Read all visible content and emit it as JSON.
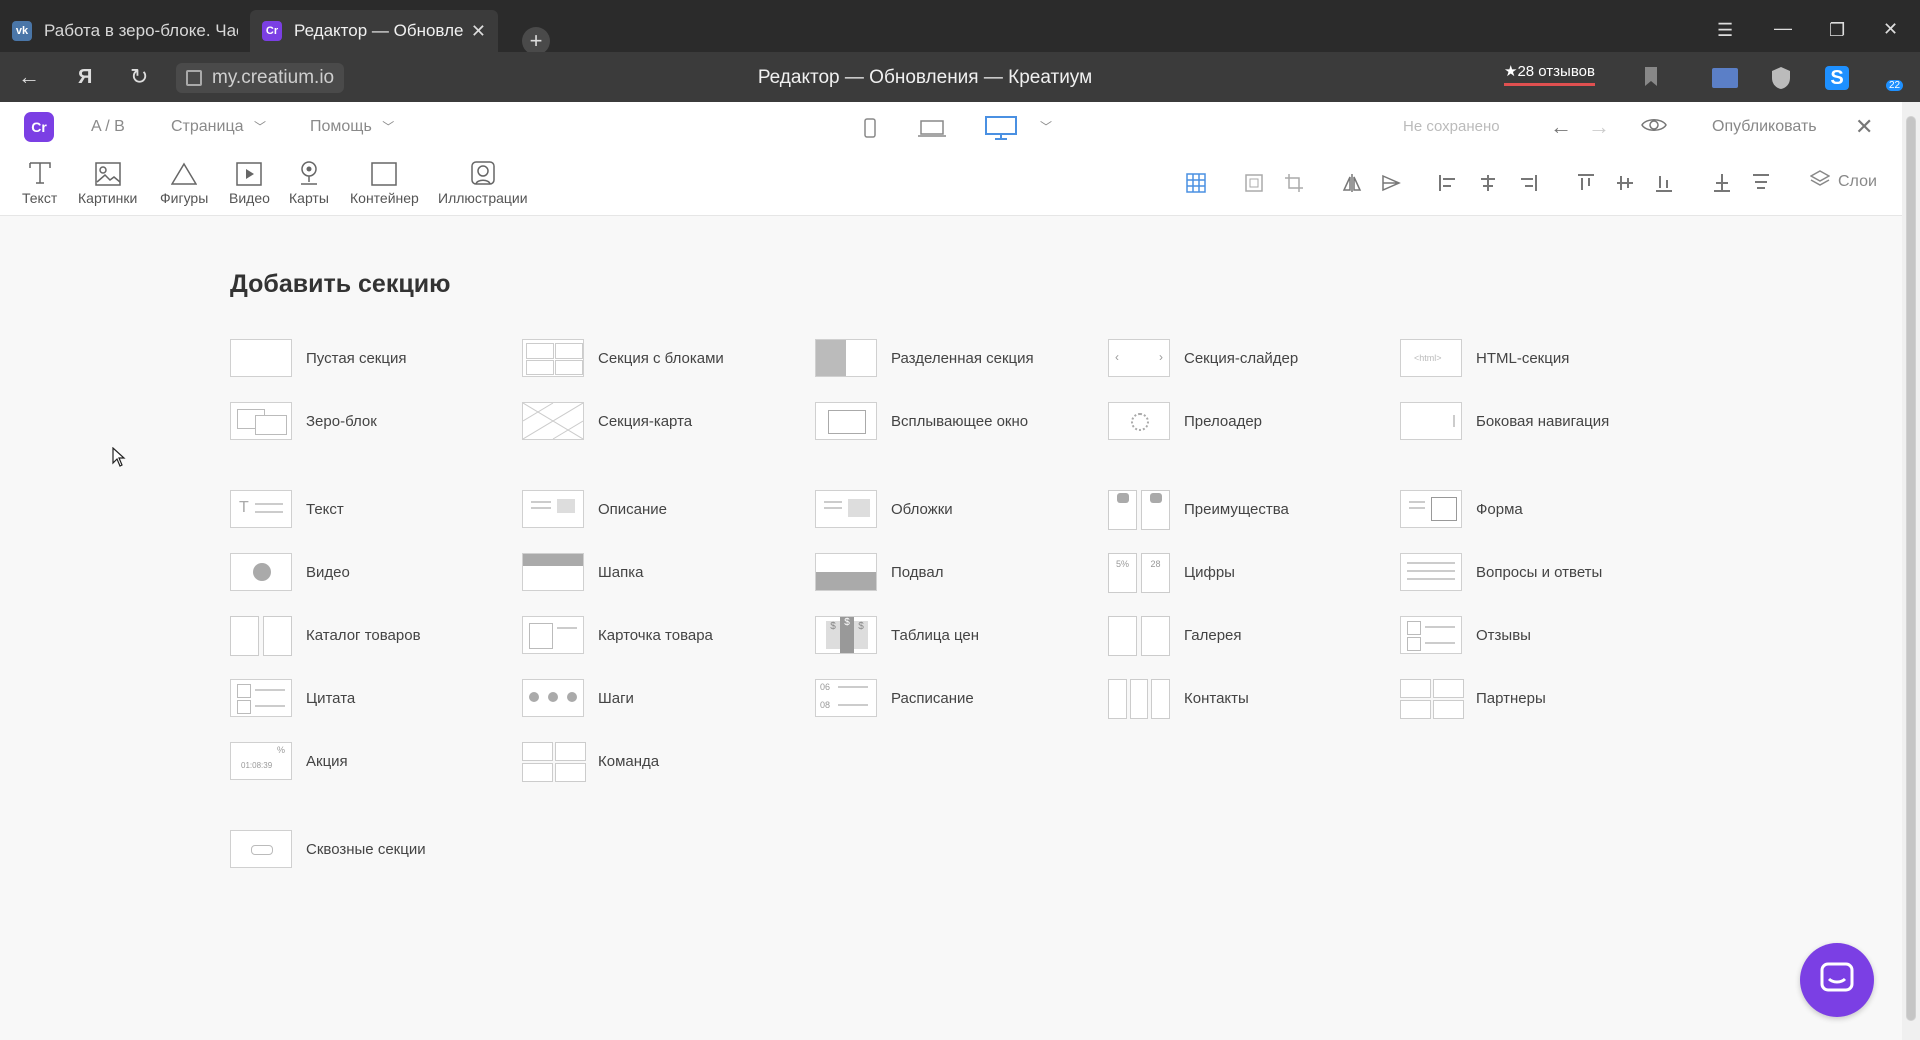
{
  "browser": {
    "tabs": [
      {
        "title": "Работа в зеро-блоке. Час",
        "favicon": "vk-icon",
        "active": false
      },
      {
        "title": "Редактор — Обновлени",
        "favicon": "creatium-icon",
        "active": true
      }
    ],
    "new_tab_symbol": "+",
    "url": "my.creatium.io",
    "page_title": "Редактор — Обновления — Креатиум",
    "reviews_label": "★28 отзывов",
    "ext_badge": "22",
    "colors": {
      "chrome_dark": "#2b2b2b",
      "chrome_mid": "#3b3b3b",
      "vk_blue": "#4a76a8",
      "ext_blue": "#1e90ff"
    }
  },
  "editor": {
    "ab_label": "A / B",
    "menu": {
      "page": "Страница",
      "help": "Помощь"
    },
    "status": "Не сохранено",
    "publish": "Опубликовать",
    "layers": "Слои",
    "tools": [
      {
        "label": "Текст",
        "icon": "text-icon"
      },
      {
        "label": "Картинки",
        "icon": "image-icon"
      },
      {
        "label": "Фигуры",
        "icon": "shape-icon"
      },
      {
        "label": "Видео",
        "icon": "video-icon"
      },
      {
        "label": "Карты",
        "icon": "map-pin-icon"
      },
      {
        "label": "Контейнер",
        "icon": "container-icon"
      },
      {
        "label": "Иллюстрации",
        "icon": "illustration-icon"
      }
    ],
    "accent": "#7b3fe4",
    "active_device": "desktop"
  },
  "sections": {
    "heading": "Добавить секцию",
    "group1": [
      [
        "Пустая секция",
        "Секция с блоками",
        "Разделенная секция",
        "Секция-слайдер",
        "HTML-секция"
      ],
      [
        "Зеро-блок",
        "Секция-карта",
        "Всплывающее окно",
        "Прелоадер",
        "Боковая навигация"
      ]
    ],
    "group2": [
      [
        "Текст",
        "Описание",
        "Обложки",
        "Преимущества",
        "Форма"
      ],
      [
        "Видео",
        "Шапка",
        "Подвал",
        "Цифры",
        "Вопросы и ответы"
      ],
      [
        "Каталог товаров",
        "Карточка товара",
        "Таблица цен",
        "Галерея",
        "Отзывы"
      ],
      [
        "Цитата",
        "Шаги",
        "Расписание",
        "Контакты",
        "Партнеры"
      ],
      [
        "Акция",
        "Команда"
      ]
    ],
    "through": "Сквозные секции",
    "html_thumb_text": "<html>",
    "thumb_digits": {
      "numbers_left": "5%",
      "numbers_right": "28",
      "schedule": "06",
      "schedule2": "08",
      "promo_pct": "%",
      "promo_time": "01:08:39",
      "price": "$"
    }
  }
}
